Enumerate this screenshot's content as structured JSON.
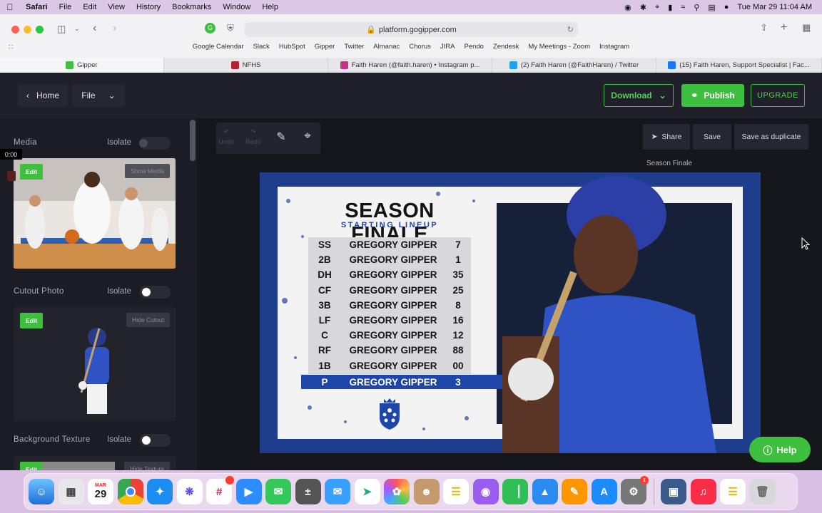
{
  "menubar": {
    "app": "Safari",
    "items": [
      "File",
      "Edit",
      "View",
      "History",
      "Bookmarks",
      "Window",
      "Help"
    ],
    "clock": "Tue Mar 29  11:04 AM"
  },
  "browser": {
    "url": "platform.gogipper.com",
    "favorites": [
      "Google Calendar",
      "Slack",
      "HubSpot",
      "Gipper",
      "Twitter",
      "Almanac",
      "Chorus",
      "JIRA",
      "Pendo",
      "Zendesk",
      "My Meetings - Zoom",
      "Instagram"
    ],
    "tabs": [
      {
        "label": "Gipper",
        "color": "#3fbf3f"
      },
      {
        "label": "NFHS",
        "color": "#b22234"
      },
      {
        "label": "Faith Haren (@faith.haren) • Instagram p...",
        "color": "#c13584"
      },
      {
        "label": "(2) Faith Haren (@FaithHaren) / Twitter",
        "color": "#1da1f2"
      },
      {
        "label": "(15) Faith Haren, Support Specialist | Fac...",
        "color": "#1877f2"
      }
    ]
  },
  "header": {
    "home": "Home",
    "file": "File",
    "download": "Download",
    "publish": "Publish",
    "upgrade": "UPGRADE"
  },
  "panel": {
    "timer": "0:00",
    "media": {
      "title": "Media",
      "isolate": "Isolate",
      "edit": "Edit",
      "action": "Show Media"
    },
    "cutout": {
      "title": "Cutout Photo",
      "isolate": "Isolate",
      "edit": "Edit",
      "action": "Hide Cutout"
    },
    "texture": {
      "title": "Background Texture",
      "isolate": "Isolate",
      "edit": "Edit",
      "action": "Hide Texture"
    }
  },
  "canvas": {
    "undo": "Undo",
    "redo": "Redo",
    "share": "Share",
    "save": "Save",
    "save_duplicate": "Save as duplicate",
    "design_name": "Season Finale",
    "help": "Help"
  },
  "poster": {
    "title": "SEASON FINALE",
    "subtitle": "STARTING LINEUP",
    "lineup": [
      {
        "pos": "SS",
        "name": "GREGORY GIPPER",
        "num": "7"
      },
      {
        "pos": "2B",
        "name": "GREGORY GIPPER",
        "num": "1"
      },
      {
        "pos": "DH",
        "name": "GREGORY GIPPER",
        "num": "35"
      },
      {
        "pos": "CF",
        "name": "GREGORY GIPPER",
        "num": "25"
      },
      {
        "pos": "3B",
        "name": "GREGORY GIPPER",
        "num": "8"
      },
      {
        "pos": "LF",
        "name": "GREGORY GIPPER",
        "num": "16"
      },
      {
        "pos": "C",
        "name": "GREGORY GIPPER",
        "num": "12"
      },
      {
        "pos": "RF",
        "name": "GREGORY GIPPER",
        "num": "88"
      },
      {
        "pos": "1B",
        "name": "GREGORY GIPPER",
        "num": "00"
      }
    ],
    "highlight": {
      "pos": "P",
      "name": "GREGORY GIPPER",
      "num": "3"
    }
  },
  "dock": {
    "calendar_month": "MAR",
    "calendar_day": "29",
    "badge_slack": "",
    "badge_settings": "1"
  },
  "colors": {
    "accent": "#3fbf3f",
    "poster_blue": "#1e45a8",
    "app_bg": "#1c1d24"
  }
}
